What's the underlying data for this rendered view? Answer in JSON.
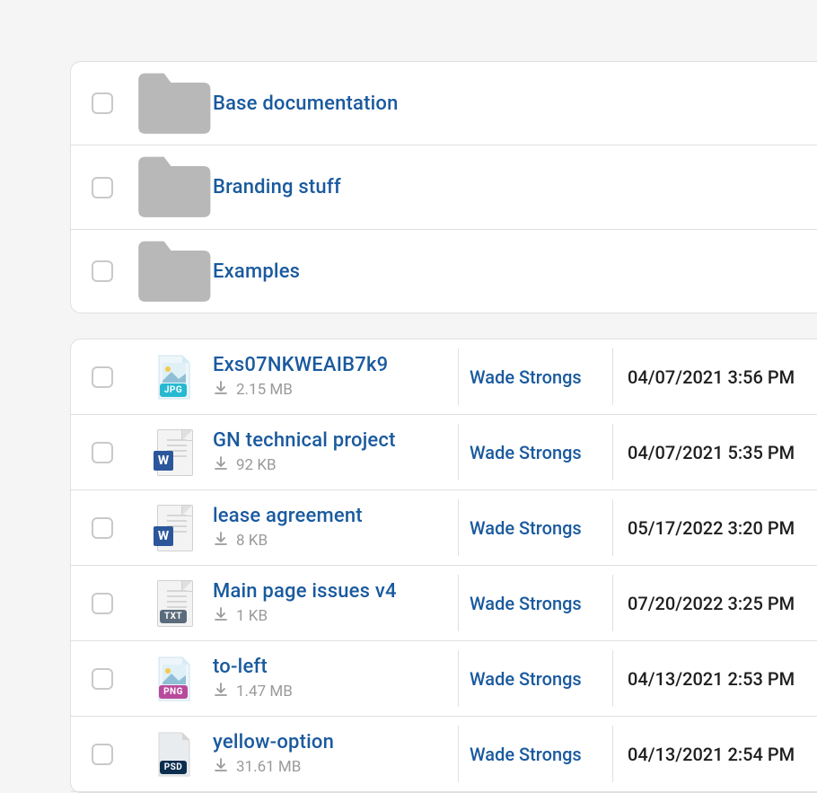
{
  "folders": [
    {
      "name": "Base documentation"
    },
    {
      "name": "Branding stuff"
    },
    {
      "name": "Examples"
    }
  ],
  "files": [
    {
      "name": "Exs07NKWEAIB7k9",
      "size": "2.15 MB",
      "author": "Wade Strongs",
      "date": "04/07/2021 3:56 PM",
      "type": "jpg"
    },
    {
      "name": "GN technical project",
      "size": "92 KB",
      "author": "Wade Strongs",
      "date": "04/07/2021 5:35 PM",
      "type": "doc"
    },
    {
      "name": "lease agreement",
      "size": "8 KB",
      "author": "Wade Strongs",
      "date": "05/17/2022 3:20 PM",
      "type": "doc"
    },
    {
      "name": "Main page issues v4",
      "size": "1 KB",
      "author": "Wade Strongs",
      "date": "07/20/2022 3:25 PM",
      "type": "txt"
    },
    {
      "name": "to-left",
      "size": "1.47 MB",
      "author": "Wade Strongs",
      "date": "04/13/2021 2:53 PM",
      "type": "png"
    },
    {
      "name": "yellow-option",
      "size": "31.61 MB",
      "author": "Wade Strongs",
      "date": "04/13/2021 2:54 PM",
      "type": "psd"
    }
  ],
  "icon_labels": {
    "jpg": "JPG",
    "png": "PNG",
    "txt": "TXT",
    "psd": "PSD",
    "doc": "W"
  }
}
